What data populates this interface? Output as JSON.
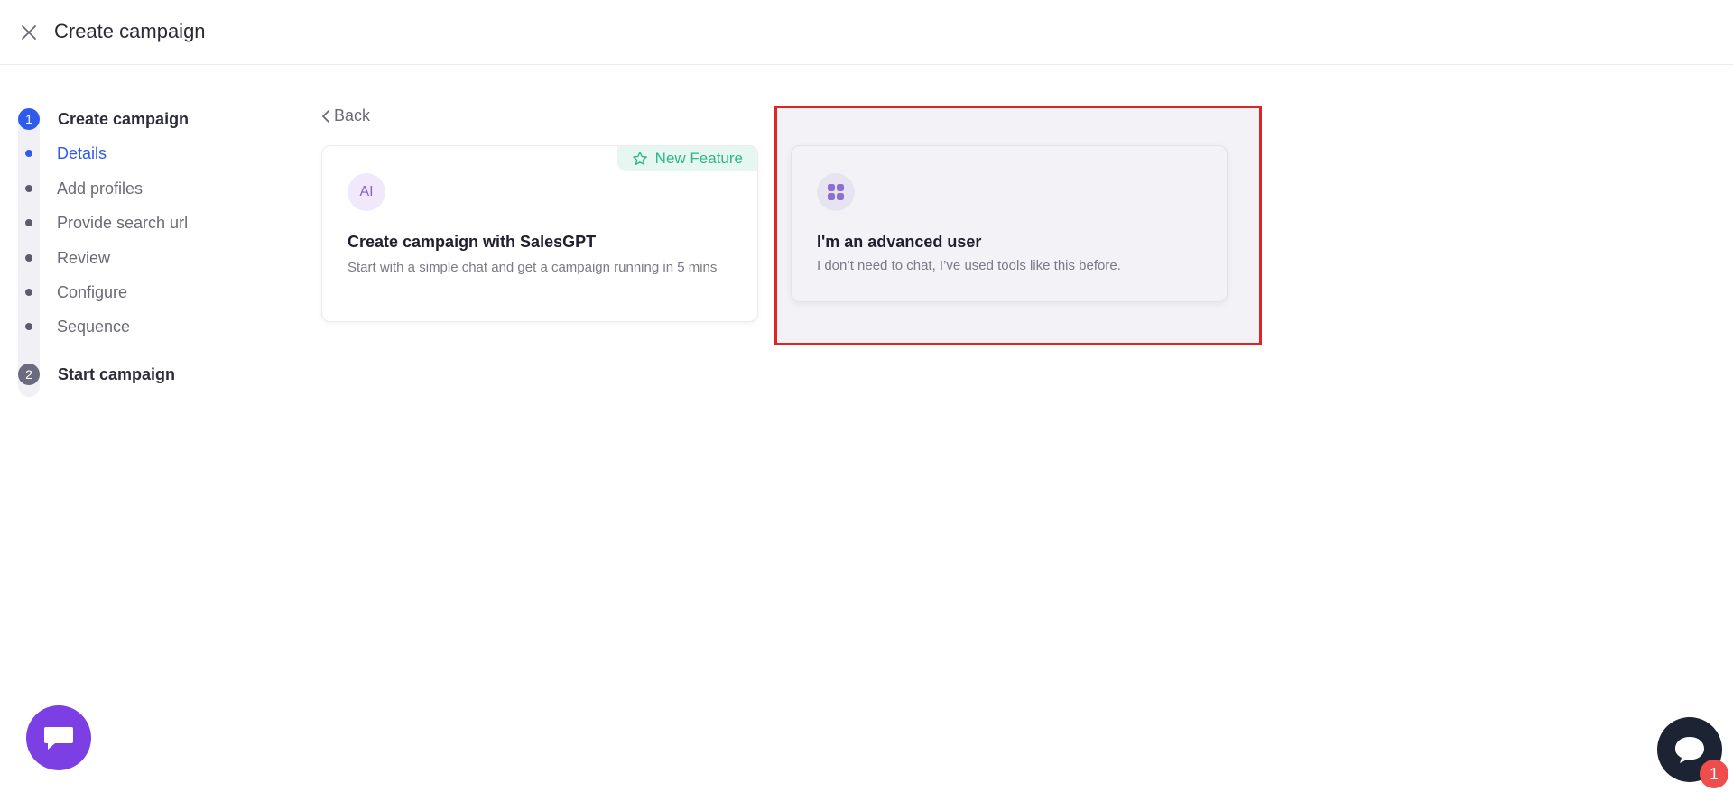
{
  "header": {
    "title": "Create campaign",
    "close_icon": "close-icon"
  },
  "stepper": {
    "steps": [
      {
        "number": "1",
        "label": "Create campaign",
        "status": "active"
      },
      {
        "number": "2",
        "label": "Start campaign",
        "status": "inactive"
      }
    ],
    "sub_items": [
      {
        "label": "Details",
        "active": true
      },
      {
        "label": "Add profiles",
        "active": false
      },
      {
        "label": "Provide search url",
        "active": false
      },
      {
        "label": "Review",
        "active": false
      },
      {
        "label": "Configure",
        "active": false
      },
      {
        "label": "Sequence",
        "active": false
      }
    ]
  },
  "main": {
    "back_label": "Back",
    "cards": {
      "ai": {
        "icon_text": "AI",
        "badge": "New Feature",
        "title": "Create campaign with SalesGPT",
        "description": "Start with a simple chat and get a campaign running in 5 mins"
      },
      "advanced": {
        "icon": "grid-icon",
        "title": "I'm an advanced user",
        "description": "I don’t need to chat, I’ve used tools like this before."
      }
    }
  },
  "widgets": {
    "chat_icon": "chat-bubble-icon",
    "help_icon": "support-bubble-icon",
    "notification_count": "1"
  },
  "colors": {
    "primary": "#2f5bea",
    "accent_purple": "#7b3fe4",
    "new_feature_green": "#2fb58a",
    "highlight_red": "#e02424"
  }
}
